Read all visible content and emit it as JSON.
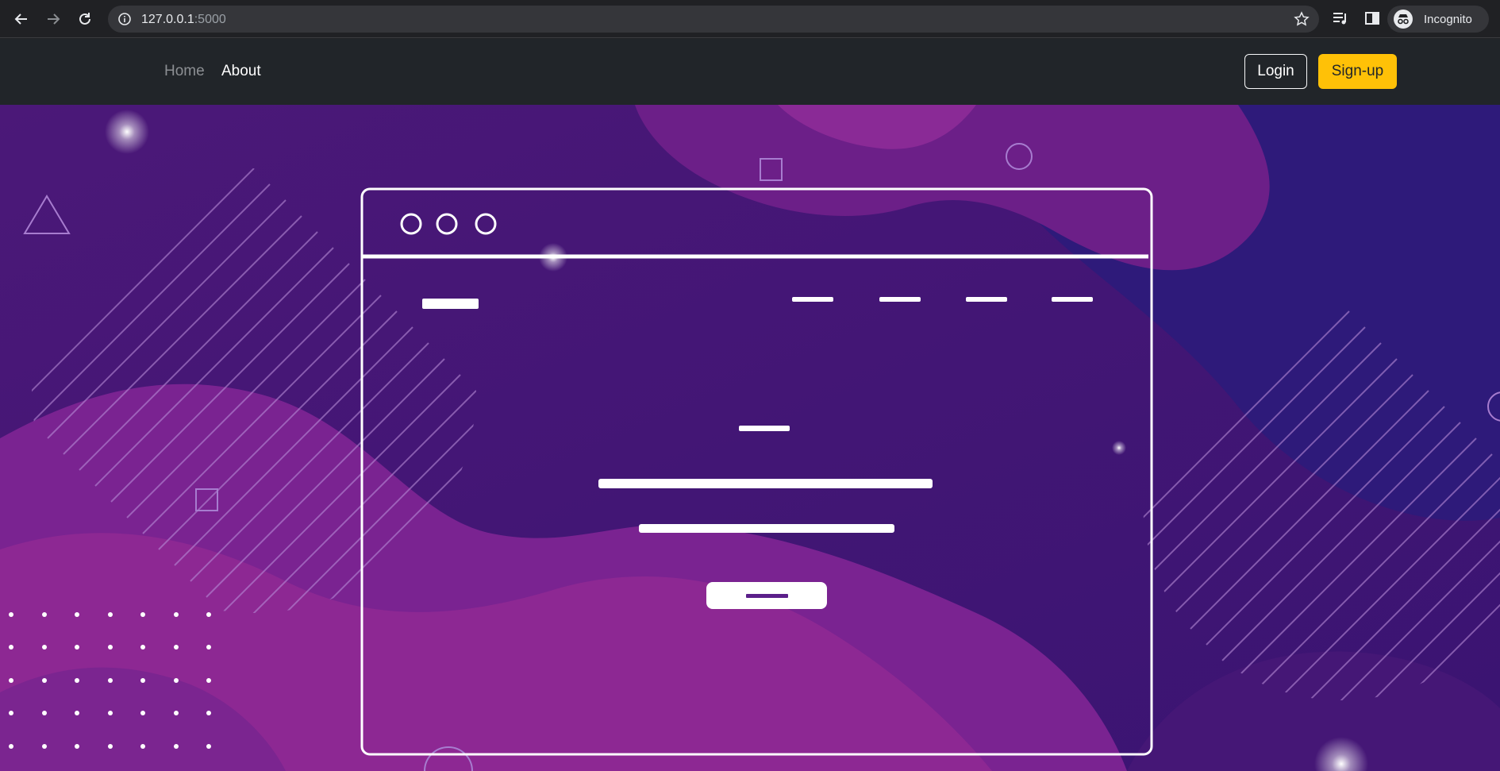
{
  "browser": {
    "url_host": "127.0.0.1",
    "url_port": ":5000",
    "profile_label": "Incognito",
    "icons": [
      "back-icon",
      "forward-icon",
      "reload-icon",
      "info-icon",
      "star-icon",
      "media-queue-icon",
      "side-panel-icon",
      "incognito-icon"
    ]
  },
  "navbar": {
    "home_label": "Home",
    "about_label": "About",
    "login_label": "Login",
    "signup_label": "Sign-up"
  },
  "colors": {
    "navbar_bg": "#212529",
    "signup_bg": "#ffc107",
    "hero_purple": "#4f1a7a",
    "hero_magenta": "#8e2590",
    "hero_blue": "#2d1a78"
  }
}
